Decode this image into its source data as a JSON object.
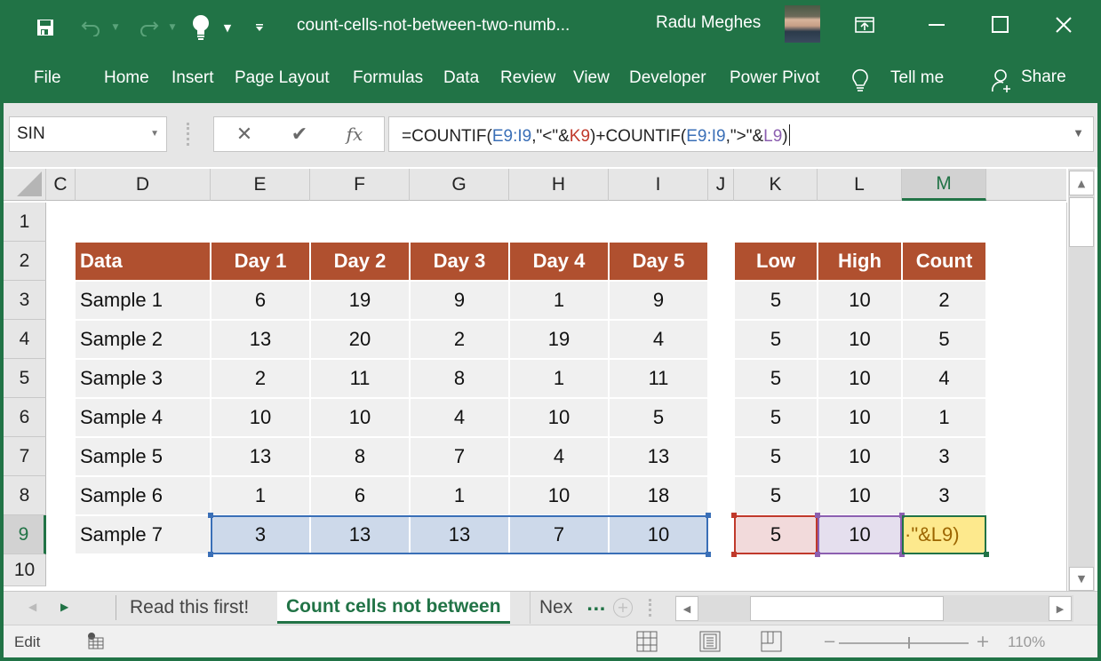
{
  "window": {
    "title": "count-cells-not-between-two-numb...",
    "user_name": "Radu Meghes",
    "controls": [
      "ribbon-display-options",
      "minimize",
      "maximize",
      "close"
    ]
  },
  "quick_access": {
    "icons": [
      "save-icon",
      "undo-icon",
      "redo-icon",
      "lightbulb-icon",
      "customize-icon"
    ]
  },
  "ribbon": {
    "tabs": [
      "File",
      "Home",
      "Insert",
      "Page Layout",
      "Formulas",
      "Data",
      "Review",
      "View",
      "Developer",
      "Power Pivot"
    ],
    "tell_me": "Tell me",
    "share": "Share"
  },
  "formula_bar": {
    "name_box": "SIN",
    "cancel_icon": "✕",
    "enter_icon": "✔",
    "fx_label": "fx",
    "formula_parts": [
      {
        "text": "=COUNTIF(",
        "color": "default"
      },
      {
        "text": "E9:I9",
        "color": "blue"
      },
      {
        "text": ",\"<\"&",
        "color": "default"
      },
      {
        "text": "K9",
        "color": "red"
      },
      {
        "text": ")+COUNTIF(",
        "color": "default"
      },
      {
        "text": "E9:I9",
        "color": "blue"
      },
      {
        "text": ",\">\"&",
        "color": "default"
      },
      {
        "text": "L9",
        "color": "purple"
      },
      {
        "text": ")",
        "color": "default"
      }
    ]
  },
  "grid": {
    "columns": [
      "C",
      "D",
      "E",
      "F",
      "G",
      "H",
      "I",
      "J",
      "K",
      "L",
      "M"
    ],
    "selected_column": "M",
    "rows": [
      "1",
      "2",
      "3",
      "4",
      "5",
      "6",
      "7",
      "8",
      "9",
      "10"
    ],
    "selected_row": "9",
    "main_table": {
      "headers": [
        "Data",
        "Day 1",
        "Day 2",
        "Day 3",
        "Day 4",
        "Day 5"
      ],
      "rows": [
        [
          "Sample 1",
          "6",
          "19",
          "9",
          "1",
          "9"
        ],
        [
          "Sample 2",
          "13",
          "20",
          "2",
          "19",
          "4"
        ],
        [
          "Sample 3",
          "2",
          "11",
          "8",
          "1",
          "11"
        ],
        [
          "Sample 4",
          "10",
          "10",
          "4",
          "10",
          "5"
        ],
        [
          "Sample 5",
          "13",
          "8",
          "7",
          "4",
          "13"
        ],
        [
          "Sample 6",
          "1",
          "6",
          "1",
          "10",
          "18"
        ],
        [
          "Sample 7",
          "3",
          "13",
          "13",
          "7",
          "10"
        ]
      ]
    },
    "side_table": {
      "headers": [
        "Low",
        "High",
        "Count"
      ],
      "rows": [
        [
          "5",
          "10",
          "2"
        ],
        [
          "5",
          "10",
          "5"
        ],
        [
          "5",
          "10",
          "4"
        ],
        [
          "5",
          "10",
          "1"
        ],
        [
          "5",
          "10",
          "3"
        ],
        [
          "5",
          "10",
          "3"
        ],
        [
          "5",
          "10",
          "\"&L9)"
        ]
      ]
    },
    "active_cell_display": "·\"&L9)"
  },
  "sheet_tabs": {
    "tabs": [
      "Read this first!",
      "Count cells not between",
      "Nex"
    ],
    "active": "Count cells not between",
    "overflow": "..."
  },
  "status_bar": {
    "mode": "Edit",
    "zoom_level": "110%"
  },
  "colors": {
    "brand_green": "#217346",
    "header_fill": "#b0502f",
    "body_fill": "#f0f0f0",
    "ref_blue": "#3a6fb7",
    "ref_red": "#c0392b",
    "ref_purple": "#8c5fb0",
    "active_cell_fill": "#fde98d"
  }
}
